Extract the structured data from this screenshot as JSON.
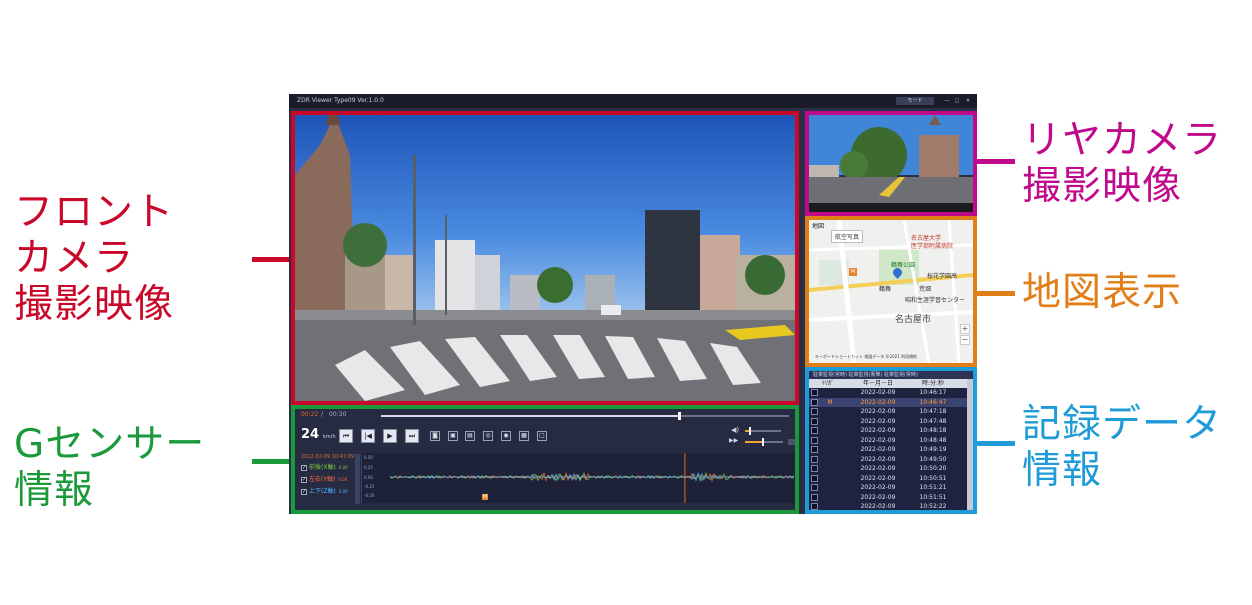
{
  "callouts": {
    "front": [
      "フロント",
      "カメラ",
      "撮影映像"
    ],
    "gsensor": [
      "Gセンサー",
      "情報"
    ],
    "rear": [
      "リヤカメラ",
      "撮影映像"
    ],
    "map": [
      "地図表示"
    ],
    "records": [
      "記録データ",
      "情報"
    ]
  },
  "colors": {
    "front": "#c9082a",
    "rear": "#c00a8c",
    "map": "#e07f18",
    "gsensor": "#1a9a3a",
    "records": "#1f9bd8"
  },
  "window": {
    "title": "ZDR Viewer Type09 Ver.1.0.0",
    "mode_button": "モード",
    "min_icon": "—",
    "max_icon": "□",
    "close_icon": "✕"
  },
  "map": {
    "panel_title": "地図",
    "tab_label": "航空写真",
    "labels": [
      "名古屋大学",
      "医学部附属病院",
      "鶴舞公園",
      "桜花学園高",
      "昭和生涯学習センター",
      "名古屋市",
      "鶴舞",
      "荒畑"
    ],
    "marker_letter": "M",
    "footer": "キーボードショートカット  地図データ ©2021  利用規約",
    "zoom_in": "+",
    "zoom_out": "−"
  },
  "records": {
    "tabs": "駐車監視(常時) 駐車監視(衝撃) 駐車監視(常時)",
    "columns": [
      "ﾄﾘｶﾞ",
      "年－月－日",
      "時:分:秒"
    ],
    "rows": [
      {
        "mark": "",
        "date": "2022-02-09",
        "time": "10:46:17"
      },
      {
        "mark": "M",
        "date": "2022-02-09",
        "time": "10:46:47"
      },
      {
        "mark": "",
        "date": "2022-02-09",
        "time": "10:47:18"
      },
      {
        "mark": "",
        "date": "2022-02-09",
        "time": "10:47:48"
      },
      {
        "mark": "",
        "date": "2022-02-09",
        "time": "10:48:18"
      },
      {
        "mark": "",
        "date": "2022-02-09",
        "time": "10:48:48"
      },
      {
        "mark": "",
        "date": "2022-02-09",
        "time": "10:49:19"
      },
      {
        "mark": "",
        "date": "2022-02-09",
        "time": "10:49:50"
      },
      {
        "mark": "",
        "date": "2022-02-09",
        "time": "10:50:20"
      },
      {
        "mark": "",
        "date": "2022-02-09",
        "time": "10:50:51"
      },
      {
        "mark": "",
        "date": "2022-02-09",
        "time": "10:51:21"
      },
      {
        "mark": "",
        "date": "2022-02-09",
        "time": "10:51:51"
      },
      {
        "mark": "",
        "date": "2022-02-09",
        "time": "10:52:22"
      }
    ],
    "selected_index": 1
  },
  "player": {
    "current_time": "00:22",
    "separator": "/",
    "total_time": "00:30",
    "progress": 0.73,
    "speed_value": "24",
    "speed_unit": "km/h",
    "buttons": [
      "⏮",
      "|◀",
      "▶",
      "⏭"
    ],
    "snapshot_buttons": [
      "◙",
      "▣",
      "▤",
      "◎",
      "◉",
      "▦",
      "▢"
    ],
    "volume_icon": "◀)",
    "volume_level": 0.1,
    "rate_icon": "▶▶",
    "rate_level": 0.45
  },
  "gsensor": {
    "timestamp": "2022-02-09 10:47:09",
    "axes": [
      {
        "label": "前後(X軸)",
        "value": "0.00",
        "color": "#7ccf3a"
      },
      {
        "label": "左右(Y軸)",
        "value": "0.00",
        "color": "#ff6a3a"
      },
      {
        "label": "上下(Z軸)",
        "value": "0.00",
        "color": "#4ab6ff"
      }
    ],
    "yticks": [
      "0.50",
      "0.25",
      "0.00",
      "-0.25",
      "-0.50"
    ],
    "marker_letter": "M"
  }
}
